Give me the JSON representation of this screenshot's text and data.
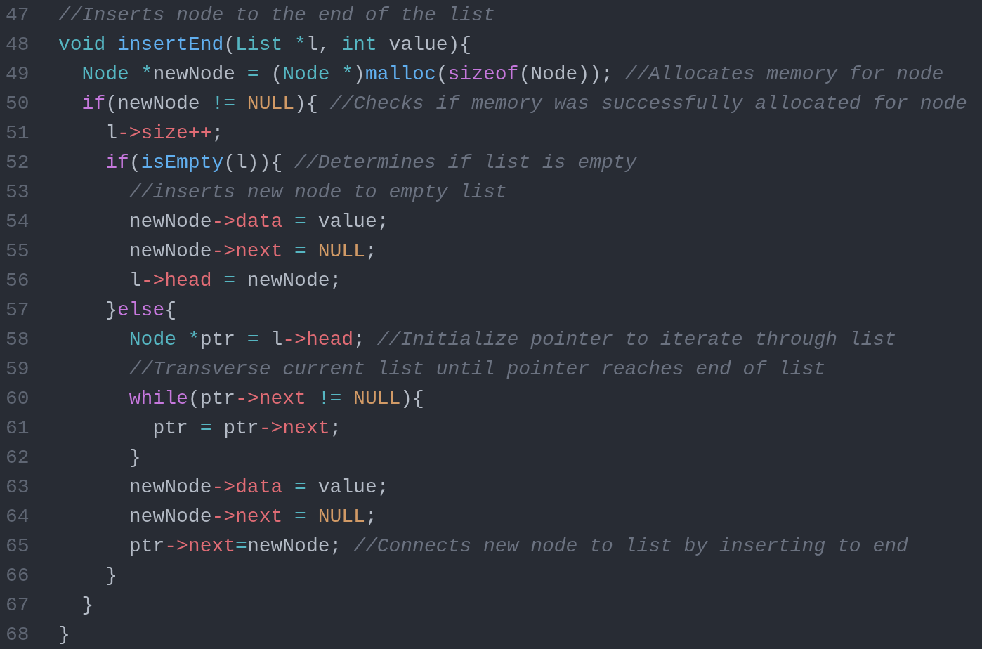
{
  "editor": {
    "lines": [
      {
        "number": "47",
        "tokens": [
          {
            "kind": "comment",
            "text": "//Inserts node to the end of the list"
          }
        ]
      },
      {
        "number": "48",
        "tokens": [
          {
            "kind": "type",
            "text": "void "
          },
          {
            "kind": "function",
            "text": "insertEnd"
          },
          {
            "kind": "plain",
            "text": "("
          },
          {
            "kind": "type",
            "text": "List "
          },
          {
            "kind": "operator",
            "text": "*"
          },
          {
            "kind": "plain",
            "text": "l, "
          },
          {
            "kind": "type",
            "text": "int "
          },
          {
            "kind": "plain",
            "text": "value){"
          }
        ],
        "children": [
          {
            "number": "49",
            "tokens": [
              {
                "kind": "type",
                "text": "Node "
              },
              {
                "kind": "operator",
                "text": "*"
              },
              {
                "kind": "plain",
                "text": "newNode "
              },
              {
                "kind": "operator",
                "text": "="
              },
              {
                "kind": "plain",
                "text": " ("
              },
              {
                "kind": "type",
                "text": "Node "
              },
              {
                "kind": "operator",
                "text": "*"
              },
              {
                "kind": "plain",
                "text": ")"
              },
              {
                "kind": "function",
                "text": "malloc"
              },
              {
                "kind": "plain",
                "text": "("
              },
              {
                "kind": "keyword",
                "text": "sizeof"
              },
              {
                "kind": "plain",
                "text": "(Node)); "
              },
              {
                "kind": "comment",
                "text": "//Allocates memory for node"
              }
            ]
          },
          {
            "number": "50",
            "tokens": [
              {
                "kind": "keyword",
                "text": "if"
              },
              {
                "kind": "plain",
                "text": "(newNode "
              },
              {
                "kind": "operator",
                "text": "!= "
              },
              {
                "kind": "constant",
                "text": "NULL"
              },
              {
                "kind": "plain",
                "text": "){ "
              },
              {
                "kind": "comment",
                "text": "//Checks if memory was successfully allocated for node"
              }
            ],
            "children": [
              {
                "number": "51",
                "tokens": [
                  {
                    "kind": "plain",
                    "text": "l"
                  },
                  {
                    "kind": "property",
                    "text": "->size++"
                  },
                  {
                    "kind": "plain",
                    "text": ";"
                  }
                ]
              },
              {
                "number": "52",
                "tokens": [
                  {
                    "kind": "keyword",
                    "text": "if"
                  },
                  {
                    "kind": "plain",
                    "text": "("
                  },
                  {
                    "kind": "function",
                    "text": "isEmpty"
                  },
                  {
                    "kind": "plain",
                    "text": "(l)){ "
                  },
                  {
                    "kind": "comment",
                    "text": "//Determines if list is empty"
                  }
                ],
                "children": [
                  {
                    "number": "53",
                    "tokens": [
                      {
                        "kind": "comment",
                        "text": "//inserts new node to empty list"
                      }
                    ]
                  },
                  {
                    "number": "54",
                    "tokens": [
                      {
                        "kind": "plain",
                        "text": "newNode"
                      },
                      {
                        "kind": "property",
                        "text": "->data "
                      },
                      {
                        "kind": "operator",
                        "text": "="
                      },
                      {
                        "kind": "plain",
                        "text": " value;"
                      }
                    ]
                  },
                  {
                    "number": "55",
                    "tokens": [
                      {
                        "kind": "plain",
                        "text": "newNode"
                      },
                      {
                        "kind": "property",
                        "text": "->next "
                      },
                      {
                        "kind": "operator",
                        "text": "= "
                      },
                      {
                        "kind": "constant",
                        "text": "NULL"
                      },
                      {
                        "kind": "plain",
                        "text": ";"
                      }
                    ]
                  },
                  {
                    "number": "56",
                    "tokens": [
                      {
                        "kind": "plain",
                        "text": "l"
                      },
                      {
                        "kind": "property",
                        "text": "->head "
                      },
                      {
                        "kind": "operator",
                        "text": "="
                      },
                      {
                        "kind": "plain",
                        "text": " newNode;"
                      }
                    ]
                  }
                ]
              },
              {
                "number": "57",
                "tokens": [
                  {
                    "kind": "plain",
                    "text": "}"
                  },
                  {
                    "kind": "keyword",
                    "text": "else"
                  },
                  {
                    "kind": "plain",
                    "text": "{"
                  }
                ],
                "children": [
                  {
                    "number": "58",
                    "tokens": [
                      {
                        "kind": "type",
                        "text": "Node "
                      },
                      {
                        "kind": "operator",
                        "text": "*"
                      },
                      {
                        "kind": "plain",
                        "text": "ptr "
                      },
                      {
                        "kind": "operator",
                        "text": "="
                      },
                      {
                        "kind": "plain",
                        "text": " l"
                      },
                      {
                        "kind": "property",
                        "text": "->head"
                      },
                      {
                        "kind": "plain",
                        "text": "; "
                      },
                      {
                        "kind": "comment",
                        "text": "//Initialize pointer to iterate through list"
                      }
                    ]
                  },
                  {
                    "number": "59",
                    "tokens": [
                      {
                        "kind": "comment",
                        "text": "//Transverse current list until pointer reaches end of list"
                      }
                    ]
                  },
                  {
                    "number": "60",
                    "tokens": [
                      {
                        "kind": "keyword",
                        "text": "while"
                      },
                      {
                        "kind": "plain",
                        "text": "(ptr"
                      },
                      {
                        "kind": "property",
                        "text": "->next "
                      },
                      {
                        "kind": "operator",
                        "text": "!= "
                      },
                      {
                        "kind": "constant",
                        "text": "NULL"
                      },
                      {
                        "kind": "plain",
                        "text": "){"
                      }
                    ],
                    "children": [
                      {
                        "number": "61",
                        "tokens": [
                          {
                            "kind": "plain",
                            "text": "ptr "
                          },
                          {
                            "kind": "operator",
                            "text": "="
                          },
                          {
                            "kind": "plain",
                            "text": " ptr"
                          },
                          {
                            "kind": "property",
                            "text": "->next"
                          },
                          {
                            "kind": "plain",
                            "text": ";"
                          }
                        ]
                      }
                    ]
                  },
                  {
                    "number": "62",
                    "tokens": [
                      {
                        "kind": "plain",
                        "text": "}"
                      }
                    ]
                  },
                  {
                    "number": "63",
                    "tokens": [
                      {
                        "kind": "plain",
                        "text": "newNode"
                      },
                      {
                        "kind": "property",
                        "text": "->data "
                      },
                      {
                        "kind": "operator",
                        "text": "="
                      },
                      {
                        "kind": "plain",
                        "text": " value;"
                      }
                    ]
                  },
                  {
                    "number": "64",
                    "tokens": [
                      {
                        "kind": "plain",
                        "text": "newNode"
                      },
                      {
                        "kind": "property",
                        "text": "->next "
                      },
                      {
                        "kind": "operator",
                        "text": "= "
                      },
                      {
                        "kind": "constant",
                        "text": "NULL"
                      },
                      {
                        "kind": "plain",
                        "text": ";"
                      }
                    ]
                  },
                  {
                    "number": "65",
                    "tokens": [
                      {
                        "kind": "plain",
                        "text": "ptr"
                      },
                      {
                        "kind": "property",
                        "text": "->next"
                      },
                      {
                        "kind": "operator",
                        "text": "="
                      },
                      {
                        "kind": "plain",
                        "text": "newNode; "
                      },
                      {
                        "kind": "comment",
                        "text": "//Connects new node to list by inserting to end"
                      }
                    ]
                  }
                ]
              },
              {
                "number": "66",
                "tokens": [
                  {
                    "kind": "plain",
                    "text": "}"
                  }
                ]
              }
            ]
          },
          {
            "number": "67",
            "tokens": [
              {
                "kind": "plain",
                "text": "}"
              }
            ]
          }
        ]
      },
      {
        "number": "68",
        "tokens": [
          {
            "kind": "plain",
            "text": "}"
          }
        ]
      }
    ]
  }
}
